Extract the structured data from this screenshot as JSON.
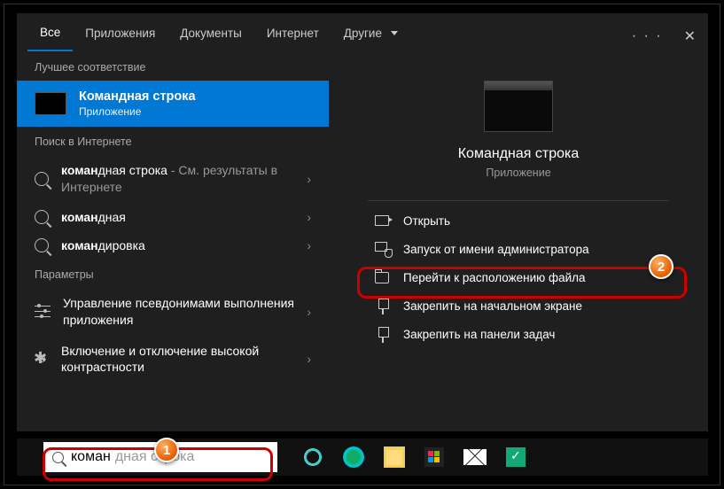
{
  "tabs": {
    "all": "Все",
    "apps": "Приложения",
    "docs": "Документы",
    "web": "Интернет",
    "more": "Другие"
  },
  "sections": {
    "best": "Лучшее соответствие",
    "web": "Поиск в Интернете",
    "settings": "Параметры"
  },
  "best_match": {
    "title_bold": "Коман",
    "title_rest": "дная строка",
    "sub": "Приложение"
  },
  "web_results": [
    {
      "bold": "коман",
      "rest": "дная строка",
      "suffix": " - См. результаты в Интернете"
    },
    {
      "bold": "коман",
      "rest": "дная",
      "suffix": ""
    },
    {
      "bold": "коман",
      "rest": "дировка",
      "suffix": ""
    }
  ],
  "settings_results": [
    "Управление псевдонимами выполнения приложения",
    "Включение и отключение высокой контрастности"
  ],
  "preview": {
    "title": "Командная строка",
    "sub": "Приложение"
  },
  "actions": {
    "open": "Открыть",
    "admin": "Запуск от имени администратора",
    "location": "Перейти к расположению файла",
    "pin_start": "Закрепить на начальном экране",
    "pin_task": "Закрепить на панели задач"
  },
  "search": {
    "typed": "коман",
    "hint": "дная строка"
  },
  "badges": {
    "one": "1",
    "two": "2"
  }
}
